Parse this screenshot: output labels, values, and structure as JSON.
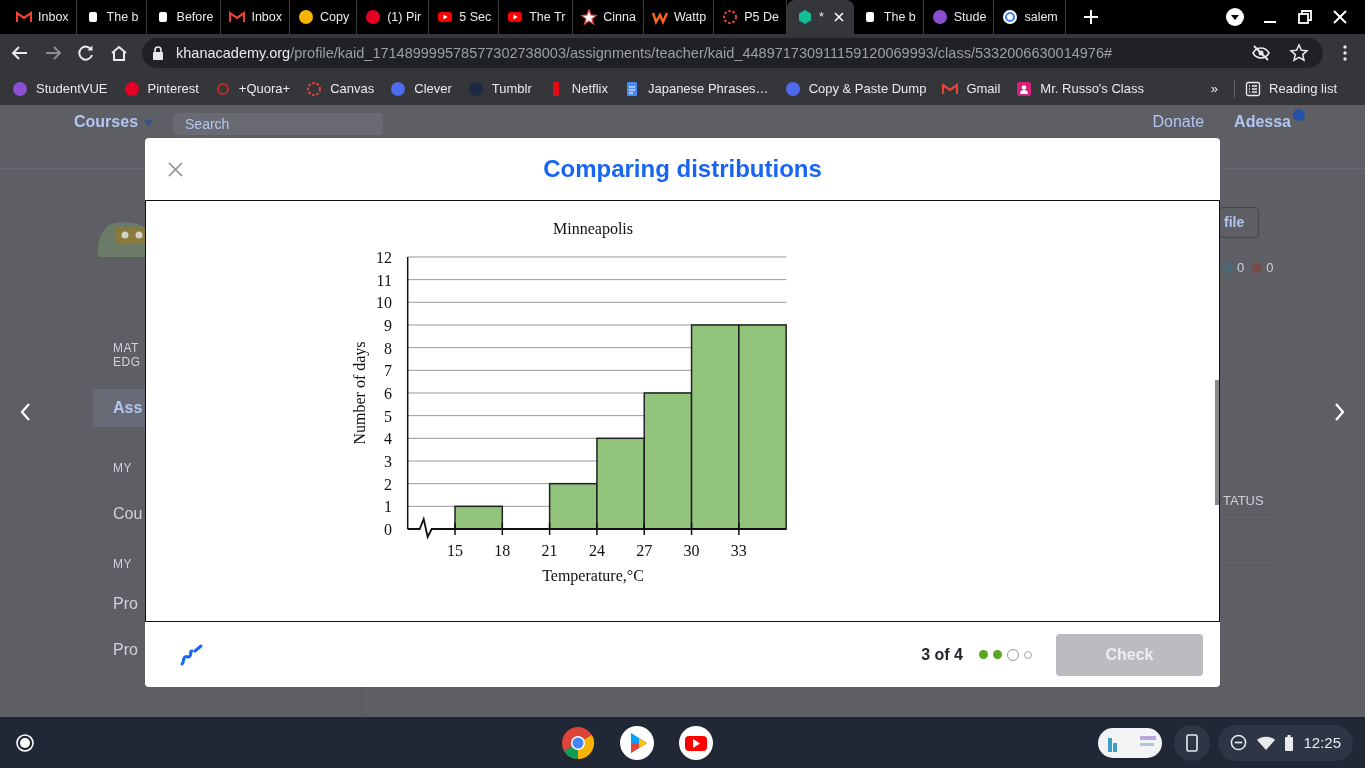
{
  "browser": {
    "tabs": [
      {
        "kind": "gmail",
        "title": "Inbox",
        "selected": false
      },
      {
        "kind": "bold",
        "title": "The b",
        "selected": false
      },
      {
        "kind": "bold",
        "title": "Before",
        "selected": false
      },
      {
        "kind": "gmail",
        "title": "Inbox",
        "selected": false
      },
      {
        "kind": "copy",
        "title": "Copy",
        "selected": false
      },
      {
        "kind": "pinterest",
        "title": "(1) Pir",
        "selected": false
      },
      {
        "kind": "youtube",
        "title": "5 Sec",
        "selected": false
      },
      {
        "kind": "youtube",
        "title": "The Tr",
        "selected": false
      },
      {
        "kind": "cinna",
        "title": "Cinna",
        "selected": false
      },
      {
        "kind": "wattpad",
        "title": "Wattp",
        "selected": false
      },
      {
        "kind": "p5",
        "title": "P5 De",
        "selected": false
      },
      {
        "kind": "khan",
        "title": "*",
        "selected": true
      },
      {
        "kind": "bold",
        "title": "The b",
        "selected": false
      },
      {
        "kind": "studentvue",
        "title": "Stude",
        "selected": false
      },
      {
        "kind": "google",
        "title": "salem",
        "selected": false
      }
    ],
    "url": {
      "host": "khanacademy.org",
      "path": "/profile/kaid_171489999578577302738003/assignments/teacher/kaid_448971730911159120069993/class/5332006630014976#"
    },
    "bookmarks": [
      {
        "kind": "studentvue",
        "label": "StudentVUE"
      },
      {
        "kind": "pinterest",
        "label": "Pinterest"
      },
      {
        "kind": "quora",
        "label": "+Quora+"
      },
      {
        "kind": "p5",
        "label": "Canvas"
      },
      {
        "kind": "clever",
        "label": "Clever"
      },
      {
        "kind": "tumblr",
        "label": "Tumblr"
      },
      {
        "kind": "netflix",
        "label": "Netflix"
      },
      {
        "kind": "docs",
        "label": "Japanese Phrases…"
      },
      {
        "kind": "clever",
        "label": "Copy & Paste Dump"
      },
      {
        "kind": "gmail",
        "label": "Gmail"
      },
      {
        "kind": "classroom",
        "label": "Mr. Russo's Class"
      }
    ],
    "overflow": "»",
    "reading_list": "Reading list"
  },
  "background_page": {
    "courses": "Courses",
    "search": {
      "placeholder": "Search"
    },
    "donate": "Donate",
    "user": "Adessa",
    "sidebar": [
      {
        "kind": "heading",
        "label": "MAT"
      },
      {
        "kind": "heading",
        "label": "EDG"
      },
      {
        "kind": "link",
        "label": "Ass",
        "selected": true
      },
      {
        "kind": "heading",
        "label": "MY"
      },
      {
        "kind": "link",
        "label": "Cou",
        "selected": false
      },
      {
        "kind": "heading",
        "label": "MY"
      },
      {
        "kind": "link",
        "label": "Pro",
        "selected": false
      },
      {
        "kind": "link",
        "label": "Pro",
        "selected": false
      }
    ],
    "profile_button": "file",
    "counts": [
      "0",
      "0"
    ],
    "column_heading": "TATUS"
  },
  "dialog": {
    "title": "Comparing distributions",
    "chart_data": {
      "type": "bar",
      "title": "Minneapolis",
      "xlabel": "Temperature,°C",
      "ylabel": "Number of days",
      "x": [
        16.5,
        19.5,
        22.5,
        25.5,
        28.5,
        31.5,
        34.5
      ],
      "values": [
        1,
        0,
        2,
        4,
        6,
        9,
        9
      ],
      "xticks": [
        15,
        18,
        21,
        24,
        27,
        30,
        33
      ],
      "yticks": [
        0,
        1,
        2,
        3,
        4,
        5,
        6,
        7,
        8,
        9,
        10,
        11,
        12
      ],
      "xlim": [
        12,
        36
      ],
      "ylim": [
        0,
        12
      ],
      "grid": true
    },
    "progress": "3 of 4",
    "steps": [
      {
        "done": true,
        "current": false
      },
      {
        "done": true,
        "current": false
      },
      {
        "done": false,
        "current": true
      },
      {
        "done": false,
        "current": false
      }
    ],
    "check": {
      "label": "Check",
      "disabled": true
    }
  },
  "shelf": {
    "time": "12:25"
  }
}
